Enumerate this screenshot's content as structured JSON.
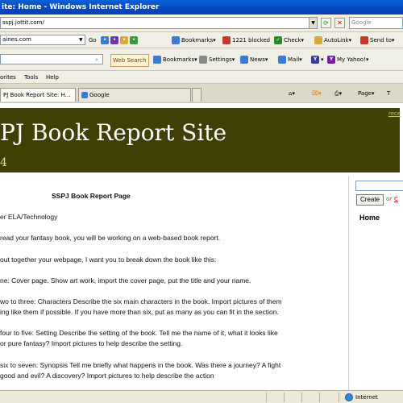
{
  "window": {
    "title": "ite: Home - Windows Internet Explorer"
  },
  "address": {
    "url": "sspj.jottit.com/",
    "search_placeholder": "Google"
  },
  "toolbar1": {
    "domain_field": "aines.com",
    "go_label": "Go",
    "bookmarks_label": "Bookmarks",
    "blocked_label": "1221 blocked",
    "check_label": "Check",
    "autolink_label": "AutoLink",
    "sendto_label": "Send to"
  },
  "toolbar2": {
    "web_search_label": "Web Search",
    "bookmarks_label": "Bookmarks",
    "settings_label": "Settings",
    "news_label": "News",
    "mail_label": "Mail",
    "myyahoo_label": "My Yahoo!"
  },
  "menu": {
    "items": [
      "orites",
      "Tools",
      "Help"
    ]
  },
  "tabs": [
    {
      "label": "PJ Book Report Site: H...",
      "active": true
    },
    {
      "label": "Google",
      "active": false
    }
  ],
  "command_bar": {
    "page_label": "Page",
    "tools_label": "T"
  },
  "site": {
    "title": "PJ Book Report Site",
    "subtitle": "4",
    "recent_link": "rece"
  },
  "article": {
    "heading": "SSPJ Book Report Page",
    "lines": [
      "er ELA/Technology",
      "read your fantasy book, you will be working on a web-based book report.",
      "out together your webpage, I want you to break down the book like this:",
      "ne: Cover page. Show art work, import the cover page, put the title and your name.",
      "wo to three: Characters Describe the six main characters in the book. Import pictures of them",
      "ing like them if possible. If you have more than six, put as many as you can fit in the section.",
      "four to five: Setting Describe the setting of the book. Tell me the name of it, what it looks like",
      "or pure fantasy? Import pictures to help describe the setting.",
      "six to seven: Synopsis Tell me briefly what happens in the book. Was there a journey? A fight",
      "good and evil? A discovery? Import pictures to help describe the action"
    ]
  },
  "sidebar": {
    "create_label": "Create",
    "or_label": "or",
    "link_label": "C",
    "home_label": "Home"
  },
  "status": {
    "zone_label": "Internet"
  },
  "colors": {
    "banner_bg": "#3f3f06",
    "titlebar": "#0348c0",
    "subtitle": "#e6e29a"
  }
}
